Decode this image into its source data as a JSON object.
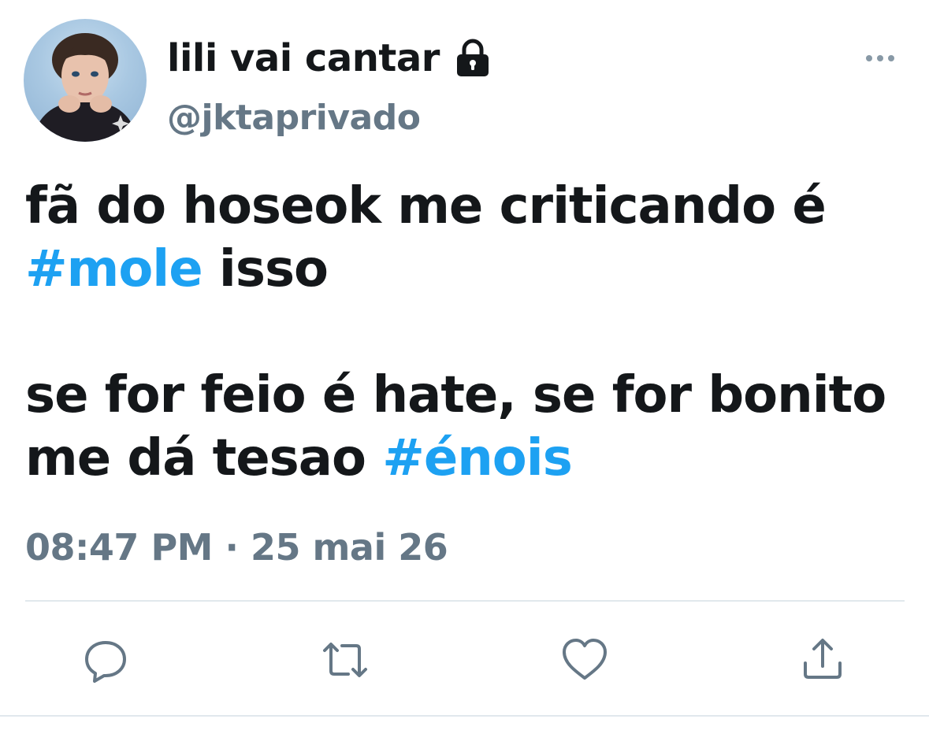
{
  "user": {
    "display_name": "lili vai cantar",
    "handle": "@jktaprivado",
    "protected_icon": "lock-icon"
  },
  "menu": {
    "icon": "more-horizontal-icon"
  },
  "tweet": {
    "line1": "fã do hoseok me criticando é",
    "hashtag1": "#mole",
    "line2_rest": " isso",
    "line3": "se for feio é hate, se for bonito",
    "line4_start": "me dá tesao ",
    "hashtag2": "#énois",
    "time": "08:47 PM",
    "separator": " · ",
    "date": "25 mai 26"
  },
  "actions": [
    {
      "name": "reply",
      "icon": "reply-icon"
    },
    {
      "name": "retweet",
      "icon": "retweet-icon"
    },
    {
      "name": "like",
      "icon": "heart-icon"
    },
    {
      "name": "share",
      "icon": "share-icon"
    }
  ],
  "colors": {
    "text": "#14171a",
    "secondary": "#657786",
    "link": "#1da1f2",
    "divider": "#e1e8ed",
    "icon": "#657786"
  }
}
